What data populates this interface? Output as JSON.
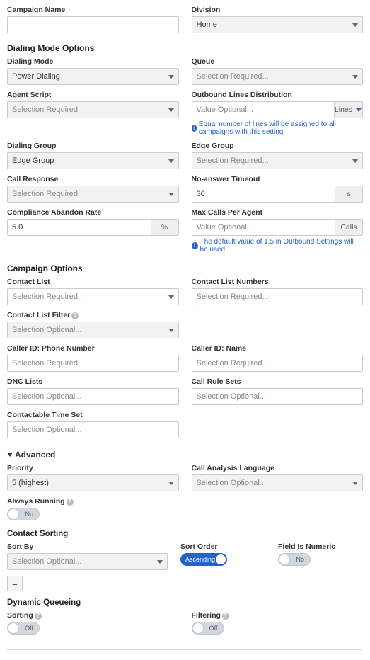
{
  "top": {
    "campaign_name": {
      "label": "Campaign Name",
      "value": ""
    },
    "division": {
      "label": "Division",
      "value": "Home"
    }
  },
  "dialing_mode_options": {
    "title": "Dialing Mode Options",
    "dialing_mode": {
      "label": "Dialing Mode",
      "value": "Power Dialing"
    },
    "queue": {
      "label": "Queue",
      "value": "Selection Required..."
    },
    "agent_script": {
      "label": "Agent Script",
      "value": "Selection Required..."
    },
    "outbound_dist": {
      "label": "Outbound Lines Distribution",
      "value": "Value Optional...",
      "unit": "Lines",
      "info": "Equal number of lines will be assigned to all campaigns with this setting"
    },
    "dialing_group": {
      "label": "Dialing Group",
      "value": "Edge Group"
    },
    "edge_group": {
      "label": "Edge Group",
      "value": "Selection Required..."
    },
    "call_response": {
      "label": "Call Response",
      "value": "Selection Required..."
    },
    "no_answer_timeout": {
      "label": "No-answer Timeout",
      "value": "30",
      "unit": "s"
    },
    "compliance_abandon_rate": {
      "label": "Compliance Abandon Rate",
      "value": "5.0",
      "unit": "%"
    },
    "max_calls_per_agent": {
      "label": "Max Calls Per Agent",
      "value": "Value Optional...",
      "unit": "Calls",
      "info": "The default value of 1.5 in Outbound Settings will be used"
    }
  },
  "campaign_options": {
    "title": "Campaign Options",
    "contact_list": {
      "label": "Contact List",
      "value": "Selection Required..."
    },
    "contact_list_numbers": {
      "label": "Contact List Numbers",
      "value": "Selection Required..."
    },
    "contact_list_filter": {
      "label": "Contact List Filter",
      "value": "Selection Optional..."
    },
    "caller_id_phone": {
      "label": "Caller ID: Phone Number",
      "value": "Selection Required..."
    },
    "caller_id_name": {
      "label": "Caller ID: Name",
      "value": "Selection Required..."
    },
    "dnc_lists": {
      "label": "DNC Lists",
      "value": "Selection Optional..."
    },
    "call_rule_sets": {
      "label": "Call Rule Sets",
      "value": "Selection Optional..."
    },
    "contactable_time_set": {
      "label": "Contactable Time Set",
      "value": "Selection Optional..."
    }
  },
  "advanced": {
    "title": "Advanced",
    "priority": {
      "label": "Priority",
      "value": "5 (highest)"
    },
    "call_analysis_lang": {
      "label": "Call Analysis Language",
      "value": "Selection Optional..."
    },
    "always_running": {
      "label": "Always Running",
      "value": "No"
    }
  },
  "contact_sorting": {
    "title": "Contact Sorting",
    "sort_by": {
      "label": "Sort By",
      "value": "Selection Optional..."
    },
    "sort_order": {
      "label": "Sort Order",
      "value": "Ascending"
    },
    "field_is_numeric": {
      "label": "Field Is Numeric",
      "value": "No"
    },
    "remove_btn": "–"
  },
  "dynamic_queueing": {
    "title": "Dynamic Queueing",
    "sorting": {
      "label": "Sorting",
      "value": "Off"
    },
    "filtering": {
      "label": "Filtering",
      "value": "Off"
    }
  }
}
